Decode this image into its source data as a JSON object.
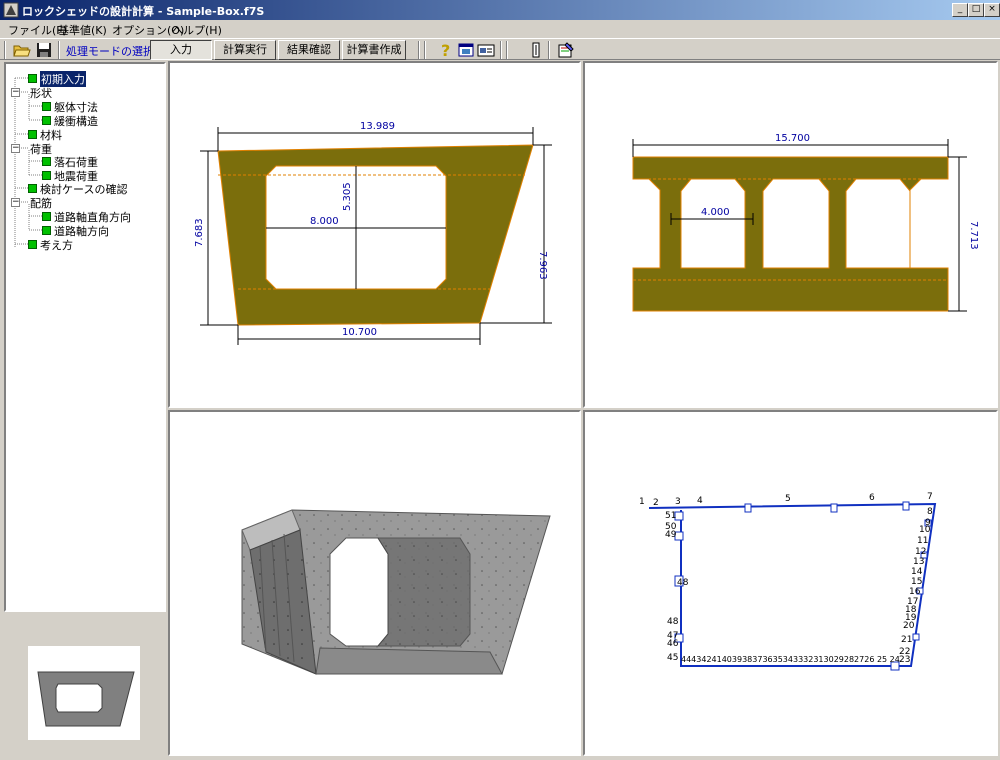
{
  "window": {
    "title": "ロックシェッドの設計計算 - Sample-Box.f7S",
    "minimize_glyph": "_",
    "maximize_glyph": "□",
    "close_glyph": "×"
  },
  "menu": [
    {
      "label": "ファイル(F)"
    },
    {
      "label": "基準値(K)"
    },
    {
      "label": "オプション(O)"
    },
    {
      "label": "ヘルプ(H)"
    }
  ],
  "toolbar": {
    "open_icon": "folder-open-icon",
    "save_icon": "floppy-disk-icon",
    "mode_label": "処理モードの選択",
    "buttons": [
      {
        "label": "入力",
        "pressed": true
      },
      {
        "label": "計算実行",
        "pressed": false
      },
      {
        "label": "結果確認",
        "pressed": false
      },
      {
        "label": "計算書作成",
        "pressed": false
      }
    ],
    "help_icon": "question-icon",
    "window_icon": "window-icon",
    "card_icon": "card-icon",
    "panel_icon": "panel-icon",
    "tool_icon": "settings-tool-icon"
  },
  "tree": {
    "items": [
      {
        "label": "初期入力",
        "selected": true
      },
      {
        "label": "形状"
      },
      {
        "label": "躯体寸法"
      },
      {
        "label": "緩衝構造"
      },
      {
        "label": "材料"
      },
      {
        "label": "荷重"
      },
      {
        "label": "落石荷重"
      },
      {
        "label": "地震荷重"
      },
      {
        "label": "検討ケースの確認"
      },
      {
        "label": "配筋"
      },
      {
        "label": "道路軸直角方向"
      },
      {
        "label": "道路軸方向"
      },
      {
        "label": "考え方"
      }
    ],
    "toggle_glyph": "−"
  },
  "cross_section": {
    "top_width": "13.989",
    "height_inner": "5.305",
    "inner_width": "8.000",
    "left_height": "7.683",
    "right_height": "7.963",
    "bottom_width": "10.700"
  },
  "longitudinal": {
    "total_width": "15.700",
    "span_width": "4.000",
    "height": "7.713"
  },
  "frame_model": {
    "node_labels_top": [
      "1",
      "2",
      "3",
      "4",
      "5",
      "6",
      "7"
    ],
    "node_labels_left": [
      "51",
      "50",
      "49",
      "48",
      "48",
      "47",
      "46",
      "45"
    ],
    "node_labels_right": [
      "8",
      "9",
      "10",
      "11",
      "12",
      "13",
      "14",
      "15",
      "16",
      "17",
      "18",
      "19",
      "20",
      "21",
      "22",
      "23"
    ],
    "bottom_label": "44434241403938373635343332313029282726 25 24"
  },
  "colors": {
    "concrete_fill": "#7b6e0c",
    "outline": "#e08000",
    "dimension_text": "#0000a0",
    "frame_line": "#1030c0"
  }
}
